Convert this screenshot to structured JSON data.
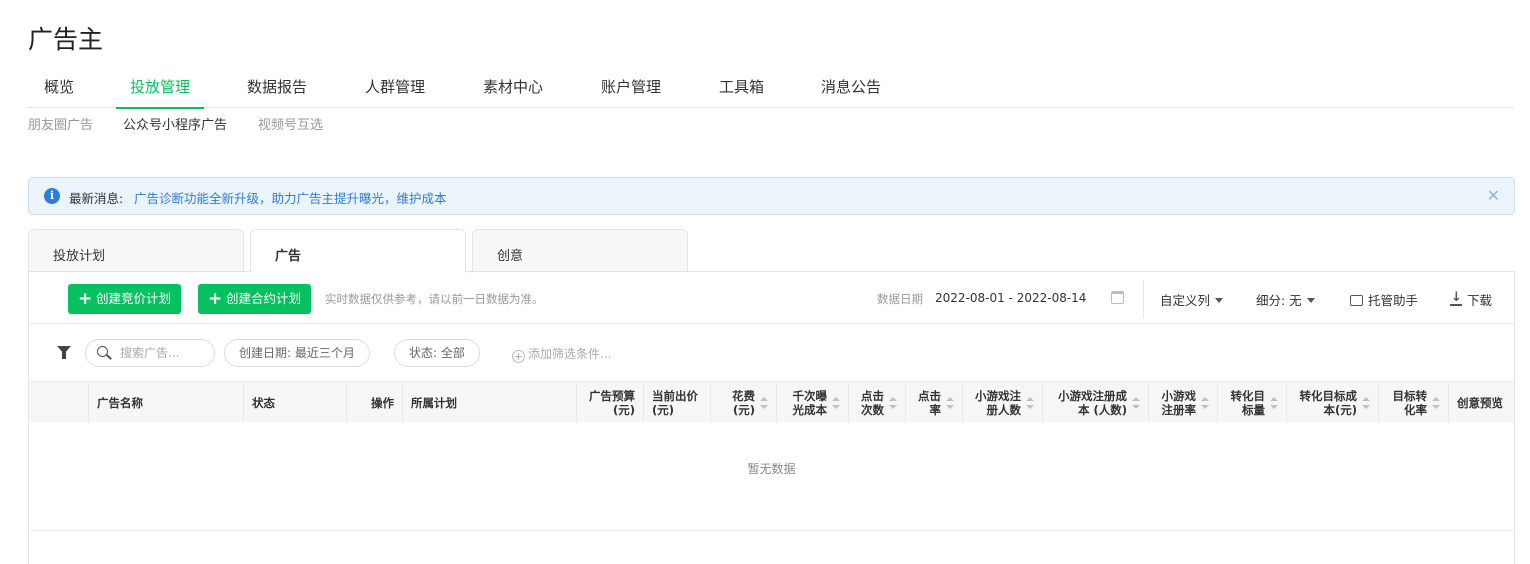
{
  "app": {
    "title": "广告主"
  },
  "main_nav": [
    "概览",
    "投放管理",
    "数据报告",
    "人群管理",
    "素材中心",
    "账户管理",
    "工具箱",
    "消息公告"
  ],
  "main_nav_active": "投放管理",
  "sub_nav": [
    "朋友圈广告",
    "公众号小程序广告",
    "视频号互选"
  ],
  "sub_nav_active": "公众号小程序广告",
  "notice": {
    "label": "最新消息:",
    "message": "广告诊断功能全新升级，助力广告主提升曝光，维护成本",
    "close": "✕",
    "info_icon": "i"
  },
  "content_tabs": [
    "投放计划",
    "广告",
    "创意"
  ],
  "content_tab_active": "广告",
  "toolbar": {
    "create_bid": "创建竞价计划",
    "create_contract": "创建合约计划",
    "tip": "实时数据仅供参考，请以前一日数据为准。",
    "date_label": "数据日期",
    "date_range": "2022-08-01 - 2022-08-14",
    "custom_columns": "自定义列",
    "breakdown": "细分: 无",
    "assistant": "托管助手",
    "download": "下载"
  },
  "filters": {
    "search_placeholder": "搜索广告...",
    "created_date": "创建日期: 最近三个月",
    "status": "状态: 全部",
    "add_filter": "添加筛选条件..."
  },
  "table": {
    "columns": [
      "广告名称",
      "状态",
      "操作",
      "所属计划",
      "广告预算\n(元)",
      "当前出价\n(元)",
      "花费\n(元)",
      "千次曝\n光成本",
      "点击\n次数",
      "点击\n率",
      "小游戏注\n册人数",
      "小游戏注册成\n本 (人数)",
      "小游戏\n注册率",
      "转化目\n标量",
      "转化目标成\n本(元)",
      "目标转\n化率",
      "创意预览"
    ],
    "empty_text": "暂无数据"
  }
}
